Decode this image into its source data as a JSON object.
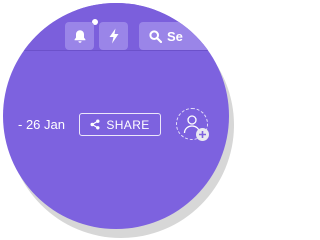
{
  "header": {
    "bell_icon": "bell-icon",
    "bolt_icon": "lightning-bolt-icon",
    "search": {
      "icon": "search-icon",
      "placeholder": "Se"
    }
  },
  "toolbar": {
    "date_range": "- 26 Jan",
    "share_label": "SHARE",
    "share_icon": "share-icon",
    "add_member_icon": "add-user-icon"
  },
  "colors": {
    "primary": "#7d62df",
    "button_fill": "#9a85e8",
    "text": "#ffffff"
  }
}
